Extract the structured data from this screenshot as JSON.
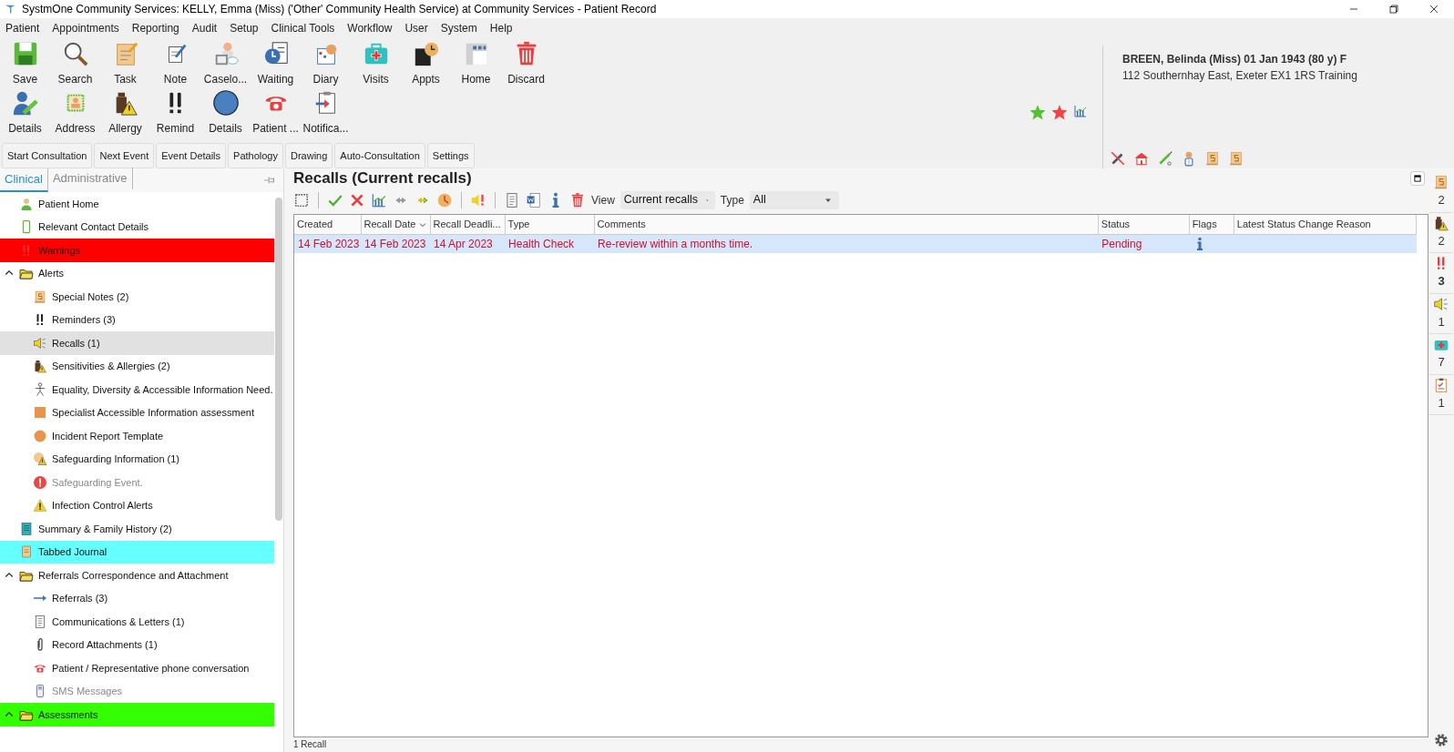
{
  "window": {
    "title": "SystmOne Community Services: KELLY, Emma (Miss) ('Other' Community Health Service) at Community Services - Patient Record"
  },
  "menu": [
    "Patient",
    "Appointments",
    "Reporting",
    "Audit",
    "Setup",
    "Clinical Tools",
    "Workflow",
    "User",
    "System",
    "Help"
  ],
  "toolbar_row_1": [
    "Save",
    "Search",
    "Task",
    "Note",
    "Caselo...",
    "Waiting",
    "Diary",
    "Visits",
    "Appts",
    "Home",
    "Discard"
  ],
  "toolbar_row_2": [
    "Details",
    "Address",
    "Allergy",
    "Remind",
    "Details",
    "Patient ...",
    "Notifica..."
  ],
  "consultation_buttons": [
    "Start Consultation",
    "Next Event",
    "Event Details",
    "Pathology",
    "Drawing",
    "Auto-Consultation",
    "Settings"
  ],
  "patient": {
    "name": "BREEN, Belinda (Miss) 01 Jan 1943 (80 y) F",
    "address": "112 Southernhay East, Exeter EX1 1RS  Training"
  },
  "side_tabs": [
    {
      "label": "Clinical",
      "selected": true
    },
    {
      "label": "Administrative",
      "selected": false
    }
  ],
  "sidebar": {
    "items": [
      {
        "label": "Patient Home",
        "selected": false
      },
      {
        "label": "Relevant Contact Details",
        "selected": false
      },
      {
        "label": "Warnings",
        "selected": false,
        "color": "#ff0000"
      },
      {
        "label": "Alerts",
        "selected": false,
        "expanded": true,
        "children": [
          {
            "label": "Special Notes (2)",
            "selected": false
          },
          {
            "label": "Reminders (3)",
            "selected": false
          },
          {
            "label": "Recalls (1)",
            "selected": true
          },
          {
            "label": "Sensitivities & Allergies (2)",
            "selected": false
          },
          {
            "label": "Equality, Diversity & Accessible Information Need.",
            "selected": false
          },
          {
            "label": "Specialist Accessible Information assessment",
            "selected": false
          },
          {
            "label": "Incident Report Template",
            "selected": false
          },
          {
            "label": "Safeguarding Information (1)",
            "selected": false
          },
          {
            "label": "Safeguarding Event.",
            "selected": false,
            "disabled": true
          },
          {
            "label": "Infection Control Alerts",
            "selected": false
          }
        ]
      },
      {
        "label": "Summary & Family History (2)",
        "selected": false
      },
      {
        "label": "Tabbed Journal",
        "selected": false,
        "color": "#66ffff"
      },
      {
        "label": "Referrals Correspondence and Attachment",
        "selected": false,
        "expanded": true,
        "children": [
          {
            "label": "Referrals (3)",
            "selected": false
          },
          {
            "label": "Communications & Letters (1)",
            "selected": false
          },
          {
            "label": "Record Attachments (1)",
            "selected": false
          },
          {
            "label": "Patient / Representative phone conversation",
            "selected": false
          },
          {
            "label": "SMS Messages",
            "selected": false,
            "disabled": true
          }
        ]
      },
      {
        "label": "Assessments",
        "selected": false,
        "expanded": true,
        "color": "#33ff00"
      }
    ]
  },
  "panel": {
    "title": "Recalls (Current recalls)",
    "view_label": "View",
    "view_value": "Current recalls",
    "type_label": "Type",
    "type_value": "All"
  },
  "table": {
    "columns": [
      {
        "label": "Created",
        "sorted": false
      },
      {
        "label": "Recall Date",
        "sorted": true
      },
      {
        "label": "Recall Deadli...",
        "sorted": false
      },
      {
        "label": "Type",
        "sorted": false
      },
      {
        "label": "Comments",
        "sorted": false
      },
      {
        "label": "Status",
        "sorted": false
      },
      {
        "label": "Flags",
        "sorted": false
      },
      {
        "label": "Latest Status Change Reason",
        "sorted": false
      }
    ],
    "rows": [
      {
        "created": "14 Feb 2023",
        "recall_date": "14 Feb 2023",
        "recall_deadline": "14 Apr 2023",
        "type": "Health Check",
        "comments": "Re-review within a months time.",
        "status": "Pending",
        "info_flag": true,
        "selected": true
      }
    ]
  },
  "status_bar": "1 Recall",
  "counters": [
    {
      "count": "2",
      "bold": false
    },
    {
      "count": "2",
      "bold": false
    },
    {
      "count": "3",
      "bold": true
    },
    {
      "count": "1",
      "bold": false
    },
    {
      "count": "7",
      "bold": false
    },
    {
      "count": "1",
      "bold": false
    }
  ]
}
